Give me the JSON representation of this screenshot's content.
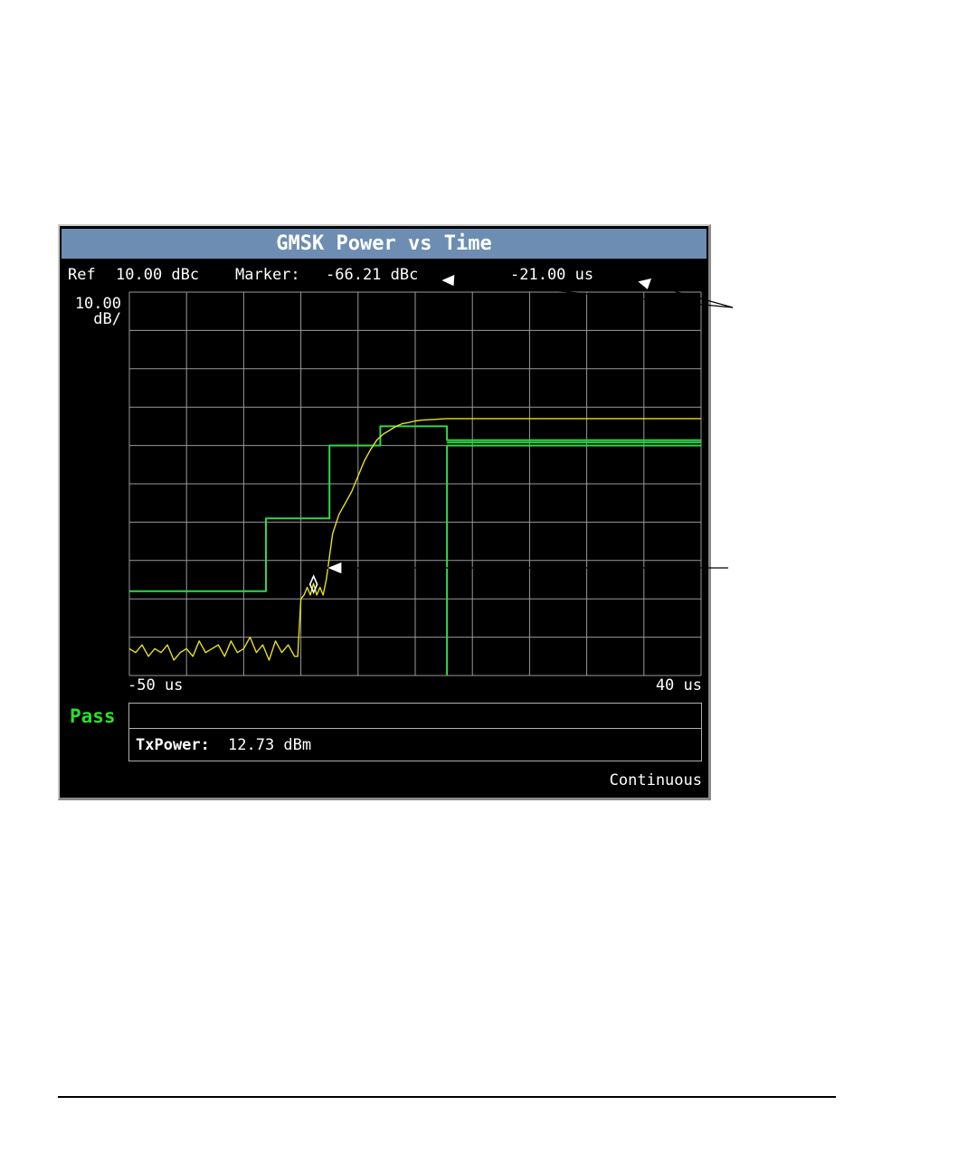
{
  "screen": {
    "title": "GMSK Power vs Time",
    "ref_label": "Ref",
    "ref_value": "10.00 dBc",
    "marker_label": "Marker:",
    "marker_value": "-66.21 dBc",
    "marker_time": "-21.00 us",
    "scale_value": "10.00",
    "scale_unit": "dB/",
    "x_start_label": "-50 us",
    "x_end_label": "40 us",
    "result_status": "Pass",
    "result_line1": "",
    "txpower_label": "TxPower:",
    "txpower_value": "12.73 dBm",
    "trigger_mode": "Continuous"
  },
  "colors": {
    "title_bar": "#6d8db3",
    "grid": "#9a9a9a",
    "mask": "#2fd84a",
    "trace": "#e6e020",
    "pass": "#28e028",
    "marker": "#ffffff"
  },
  "chart_data": {
    "type": "line",
    "title": "GMSK Power vs Time",
    "xlabel": "",
    "ylabel": "",
    "xlim": [
      -50,
      40
    ],
    "ylim": [
      -90,
      10
    ],
    "grid": true,
    "x_unit": "us",
    "y_unit": "dBc",
    "marker": {
      "x": -21.0,
      "y": -66.21
    },
    "series": [
      {
        "role": "upper-mask",
        "x": [
          -50,
          -28.5,
          -28.5,
          -18.5,
          -18.5,
          -10.5,
          -10.5,
          0,
          0,
          40
        ],
        "y": [
          -68,
          -68,
          -49,
          -49,
          -30,
          -30,
          -25,
          -25,
          -28.6,
          -28.6
        ]
      },
      {
        "role": "upper-mask-steady",
        "x": [
          0,
          40
        ],
        "y": [
          -29.2,
          -29.2
        ]
      },
      {
        "role": "lower-mask",
        "x": [
          0,
          40,
          0,
          0
        ],
        "y": [
          -30,
          -30,
          -30,
          -90
        ]
      },
      {
        "role": "trace",
        "x": [
          -50,
          -49,
          -48,
          -47,
          -46,
          -45,
          -44,
          -43,
          -42,
          -41,
          -40,
          -39,
          -38,
          -37,
          -36,
          -35,
          -34,
          -33,
          -32,
          -31,
          -30,
          -29,
          -28,
          -27,
          -26,
          -25,
          -24,
          -23.5,
          -23,
          -22.5,
          -22,
          -21.5,
          -21,
          -20.5,
          -20,
          -19.5,
          -19,
          -18,
          -17,
          -16,
          -15,
          -14,
          -13,
          -12,
          -11,
          -10,
          -9,
          -8,
          -7,
          -6,
          -5,
          -4,
          -3,
          -2,
          -1,
          0,
          5,
          10,
          20,
          30,
          40
        ],
        "y": [
          -83,
          -84,
          -82,
          -85,
          -83,
          -84,
          -82,
          -86,
          -84,
          -83,
          -85,
          -81,
          -84,
          -83,
          -82,
          -85,
          -81,
          -84,
          -83,
          -80,
          -84,
          -82,
          -86,
          -81,
          -84,
          -82,
          -85,
          -85,
          -70,
          -69,
          -67,
          -69,
          -66,
          -69,
          -67,
          -69,
          -65,
          -53,
          -48,
          -45,
          -42,
          -38,
          -34,
          -31,
          -28.5,
          -27,
          -26,
          -25,
          -24.3,
          -24,
          -23.6,
          -23.4,
          -23.3,
          -23.2,
          -23.1,
          -23,
          -23,
          -23,
          -23,
          -23,
          -23
        ]
      }
    ]
  }
}
